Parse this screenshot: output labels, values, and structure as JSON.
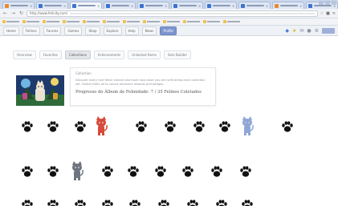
{
  "browser": {
    "tabs": [
      {
        "active": false,
        "favicon": "orange"
      },
      {
        "active": false,
        "favicon": "blue"
      },
      {
        "active": true,
        "favicon": "blue"
      },
      {
        "active": false,
        "favicon": "blue"
      },
      {
        "active": false,
        "favicon": "blue"
      },
      {
        "active": false,
        "favicon": "blue"
      },
      {
        "active": false,
        "favicon": "blue"
      },
      {
        "active": false,
        "favicon": "blue"
      },
      {
        "active": false,
        "favicon": "orange"
      },
      {
        "active": false,
        "favicon": "blue"
      }
    ],
    "url_prefix": "http://www.felinity.com/",
    "back_icon": "back-arrow-icon",
    "forward_icon": "forward-arrow-icon",
    "reload_icon": "reload-icon"
  },
  "site_nav": {
    "items": [
      "Home",
      "Felines",
      "Forums",
      "Games",
      "Shop",
      "Explore",
      "Help",
      "News",
      "Profile"
    ],
    "highlighted_index": 8
  },
  "page_tabs": {
    "items": [
      "Overview",
      "Favorites",
      "Collections",
      "Achievements",
      "Unlocked Items",
      "Sets Builder"
    ],
    "active_index": 2
  },
  "info": {
    "heading": "Collection",
    "description": "Discover every rare feline variant and track how close you are to finishing each collection set. Collect them all to unlock exclusive rewards and badges.",
    "progress": "Progresso do Álbum de Felinidade: 7 / 35 Felinos Coletados"
  },
  "collection": {
    "rows": [
      [
        "paw",
        "paw",
        "paw",
        "cat-red",
        "paw",
        "paw",
        "paw",
        "paw",
        "cat-blue",
        "paw"
      ],
      [
        "paw",
        "paw",
        "cat-gray",
        "paw",
        "paw",
        "paw",
        "paw",
        "paw",
        "paw"
      ],
      [
        "paw",
        "paw",
        "paw",
        "paw",
        "paw",
        "paw",
        "paw",
        "paw",
        "paw"
      ]
    ]
  },
  "colors": {
    "paw": "#111111",
    "cat_red": "#d84a3a",
    "cat_blue": "#8fa7d6",
    "cat_gray": "#6e7580",
    "accent": "#7d95cf"
  }
}
